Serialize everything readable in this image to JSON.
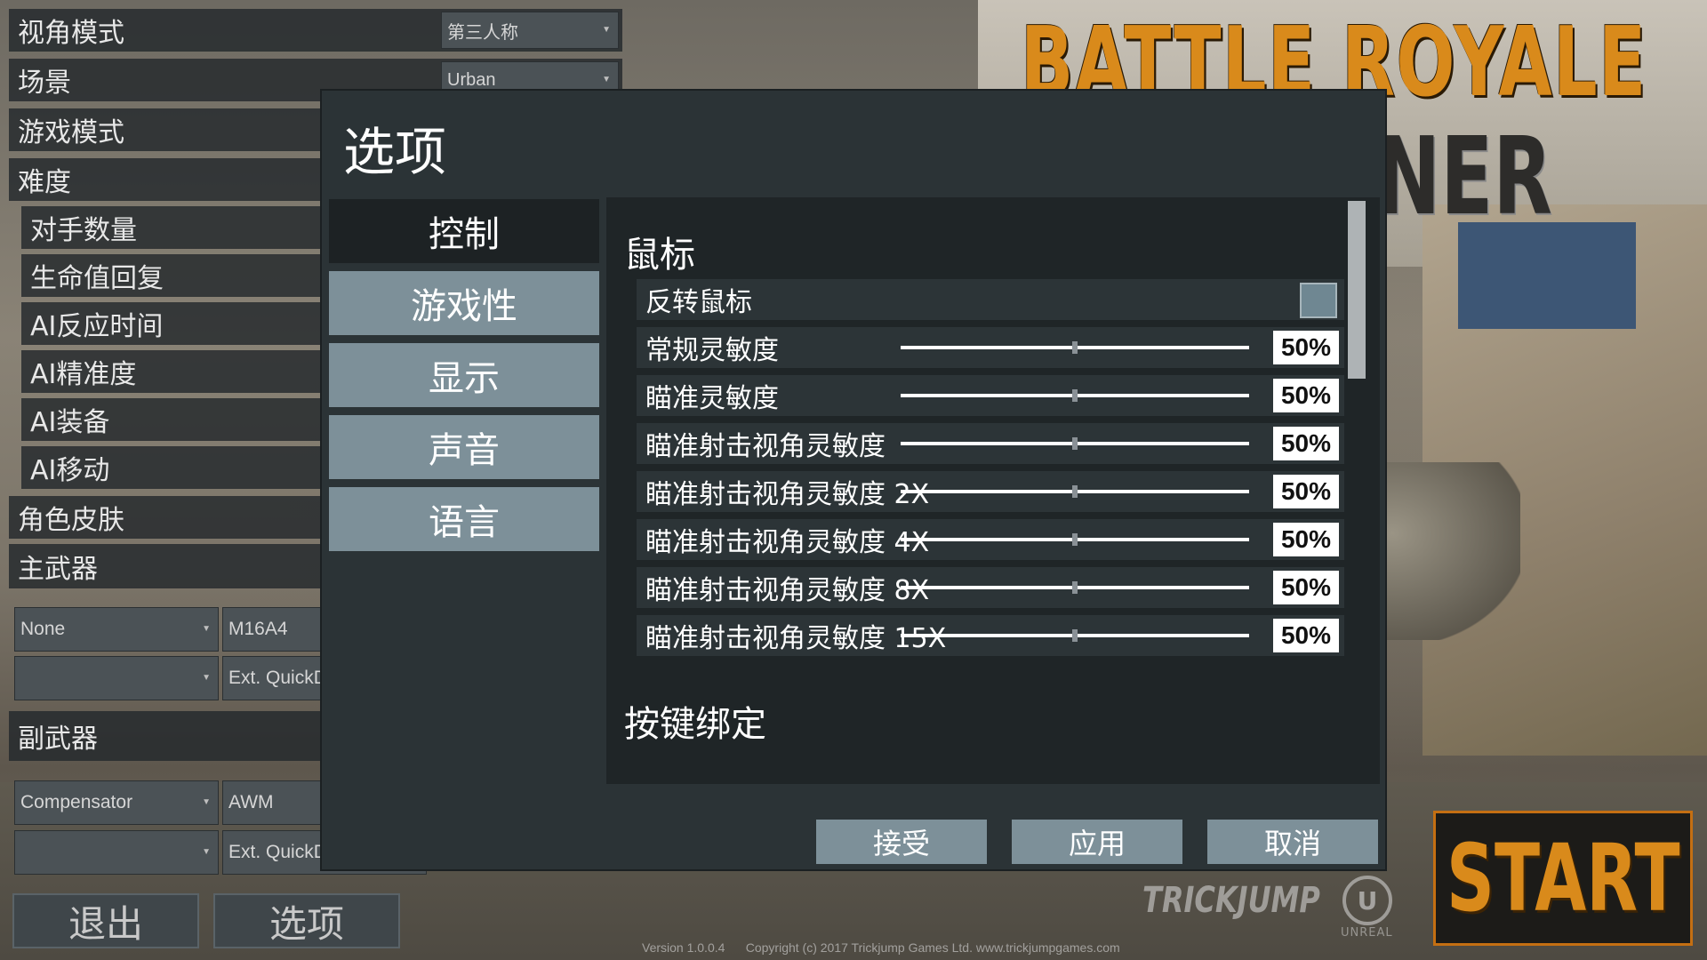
{
  "logo": {
    "line1": "BATTLE ROYALE",
    "line2": "NER"
  },
  "start": {
    "label": "START"
  },
  "brand": {
    "trickjump": "TRICKJUMP",
    "unreal": "UNREAL"
  },
  "footer": {
    "version": "Version 1.0.0.4",
    "copyright": "Copyright (c) 2017 Trickjump Games Ltd. www.trickjumpgames.com"
  },
  "left_menu": {
    "view_mode": {
      "label": "视角模式",
      "value": "第三人称"
    },
    "scene": {
      "label": "场景",
      "value": "Urban"
    },
    "game_mode": {
      "label": "游戏模式"
    },
    "difficulty": {
      "label": "难度"
    },
    "opponents": {
      "label": "对手数量"
    },
    "health_regen": {
      "label": "生命值回复"
    },
    "ai_reaction": {
      "label": "AI反应时间"
    },
    "ai_accuracy": {
      "label": "AI精准度"
    },
    "ai_equipment": {
      "label": "AI装备"
    },
    "ai_movement": {
      "label": "AI移动"
    },
    "skin": {
      "label": "角色皮肤"
    },
    "primary": {
      "label": "主武器",
      "slot1": "None",
      "slot2": "M16A4",
      "slot3": "",
      "slot4": "Ext. QuickDraw Mag",
      "ghost1": "4X"
    },
    "secondary": {
      "label": "副武器",
      "slot1": "Compensator",
      "slot2": "AWM",
      "slot3": "",
      "slot4": "Ext. QuickDraw Mag",
      "ghost1": "8X"
    },
    "exit_button": "退出",
    "options_button": "选项"
  },
  "dialog": {
    "title": "选项",
    "tabs": [
      "控制",
      "游戏性",
      "显示",
      "声音",
      "语言"
    ],
    "active_tab": 0,
    "sections": {
      "mouse": "鼠标",
      "keybind": "按键绑定"
    },
    "invert_mouse": {
      "label": "反转鼠标",
      "checked": false
    },
    "sliders": [
      {
        "label": "常规灵敏度",
        "value": "50%",
        "fraction": 0.5
      },
      {
        "label": "瞄准灵敏度",
        "value": "50%",
        "fraction": 0.5
      },
      {
        "label": "瞄准射击视角灵敏度",
        "value": "50%",
        "fraction": 0.5
      },
      {
        "label": "瞄准射击视角灵敏度 2X",
        "value": "50%",
        "fraction": 0.5
      },
      {
        "label": "瞄准射击视角灵敏度 4X",
        "value": "50%",
        "fraction": 0.5
      },
      {
        "label": "瞄准射击视角灵敏度 8X",
        "value": "50%",
        "fraction": 0.5
      },
      {
        "label": "瞄准射击视角灵敏度 15X",
        "value": "50%",
        "fraction": 0.5
      }
    ],
    "buttons": {
      "accept": "接受",
      "apply": "应用",
      "cancel": "取消"
    }
  },
  "colors": {
    "accent_orange": "#d98a1b",
    "tab_blue": "#7d9099",
    "panel_dark": "#1f2527"
  }
}
